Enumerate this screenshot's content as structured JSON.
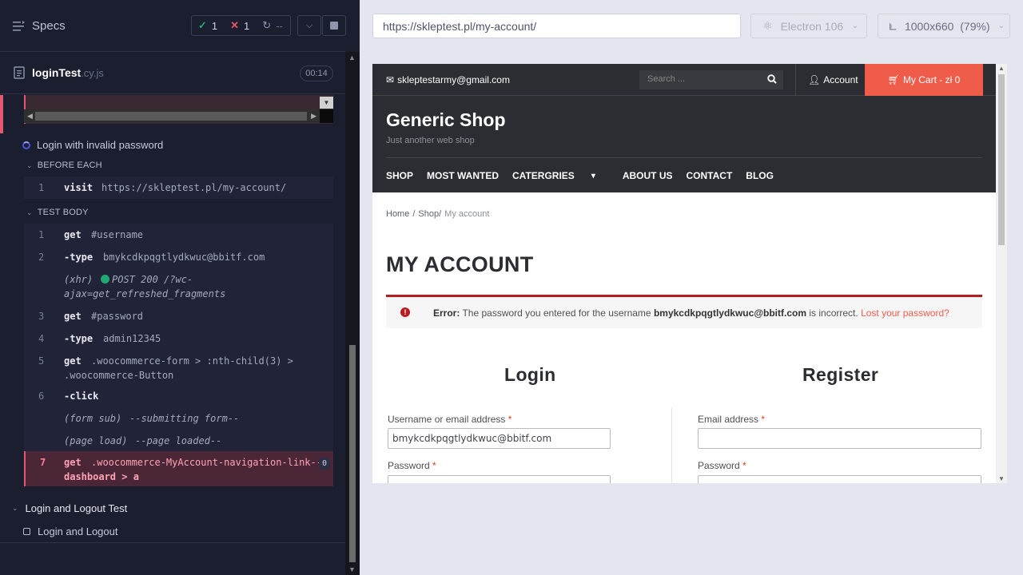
{
  "runner": {
    "specs_label": "Specs",
    "stats": {
      "passed": "1",
      "failed": "1",
      "pending": "--"
    },
    "spec_file": {
      "name": "loginTest",
      "ext": ".cy.js",
      "duration": "00:14"
    },
    "current_test": "Login with invalid password",
    "before_each": {
      "title": "BEFORE EACH",
      "commands": [
        {
          "num": "1",
          "name": "visit",
          "arg": "https://skleptest.pl/my-account/"
        }
      ]
    },
    "test_body": {
      "title": "TEST BODY",
      "commands": [
        {
          "num": "1",
          "name": "get",
          "arg": "#username"
        },
        {
          "num": "2",
          "name": "-type",
          "arg": "bmykcdkpqgtlydkwuc@bbitf.com"
        },
        {
          "num": "",
          "name": "(xhr)",
          "arg": "POST 200 /?wc-",
          "arg2": "ajax=get_refreshed_fragments"
        },
        {
          "num": "3",
          "name": "get",
          "arg": "#password"
        },
        {
          "num": "4",
          "name": "-type",
          "arg": "admin12345"
        },
        {
          "num": "5",
          "name": "get",
          "arg": ".woocommerce-form > :nth-child(3) >",
          "arg2": ".woocommerce-Button"
        },
        {
          "num": "6",
          "name": "-click",
          "arg": ""
        },
        {
          "num": "",
          "name": "(form sub)",
          "arg": "--submitting form--"
        },
        {
          "num": "",
          "name": "(page load)",
          "arg": "--page loaded--"
        }
      ],
      "failed": {
        "num": "7",
        "name": "get",
        "arg": ".woocommerce-MyAccount-navigation-link--",
        "arg2": "dashboard > a",
        "count": "0"
      }
    },
    "suite2": {
      "title": "Login and Logout Test",
      "test": "Login and Logout"
    }
  },
  "aut_bar": {
    "url": "https://skleptest.pl/my-account/",
    "browser": "Electron 106",
    "viewport": "1000x660",
    "scale": "(79%)"
  },
  "shop": {
    "email": "skleptestarmy@gmail.com",
    "search_placeholder": "Search ...",
    "account": "Account",
    "cart": "My Cart - zł 0",
    "brand": "Generic Shop",
    "tagline": "Just another web shop",
    "nav": [
      "SHOP",
      "MOST WANTED",
      "CATERGRIES",
      "ABOUT US",
      "CONTACT",
      "BLOG"
    ],
    "breadcrumb": {
      "home": "Home",
      "shop": "Shop",
      "current": "My account"
    },
    "page_title": "MY ACCOUNT",
    "error": {
      "prefix": "Error:",
      "text1": "The password you entered for the username",
      "username": "bmykcdkpqgtlydkwuc@bbitf.com",
      "text2": "is incorrect.",
      "link": "Lost your password?"
    },
    "login": {
      "heading": "Login",
      "username_label": "Username or email address",
      "username_value": "bmykcdkpqgtlydkwuc@bbitf.com",
      "password_label": "Password"
    },
    "register": {
      "heading": "Register",
      "email_label": "Email address",
      "password_label": "Password"
    },
    "required_mark": "*"
  },
  "colors": {
    "runner_bg": "#1b1e2e",
    "pass": "#1fa971",
    "fail": "#e45770",
    "cart_bg": "#f05c4a",
    "shop_dark": "#2c2d33"
  }
}
